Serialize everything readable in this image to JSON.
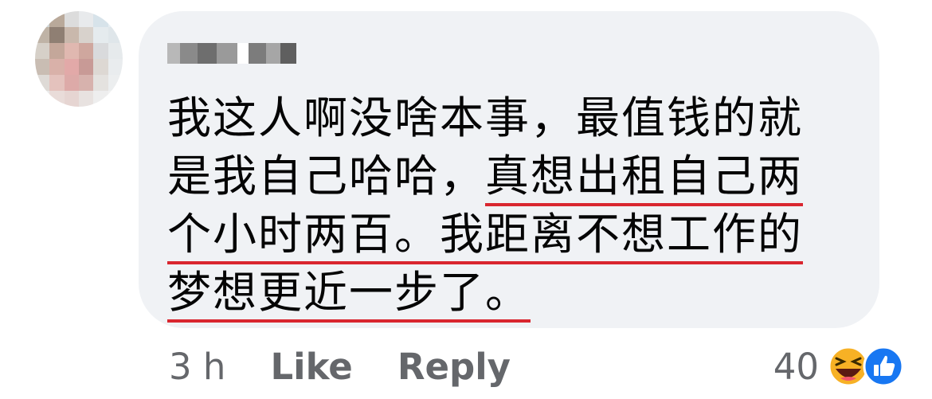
{
  "comment": {
    "lines": [
      {
        "plain": "我这人啊没啥本事，最值钱的就",
        "highlight": ""
      },
      {
        "plain": "是我自己哈哈，",
        "highlight": "真想出租自己两"
      },
      {
        "plain": "",
        "highlight": "个小时两百。我距离不想工作的"
      },
      {
        "plain": "",
        "highlight": "梦想更近一步了。"
      }
    ],
    "highlight_color": "#d9262f"
  },
  "meta": {
    "time": "3 h",
    "like_label": "Like",
    "reply_label": "Reply"
  },
  "reactions": {
    "count": "40",
    "icons": [
      "haha-icon",
      "like-icon"
    ]
  },
  "colors": {
    "bubble": "#f0f2f5",
    "text": "#050505",
    "muted": "#65676b",
    "like_blue": "#1877f2",
    "haha_yellow": "#f7b125"
  }
}
